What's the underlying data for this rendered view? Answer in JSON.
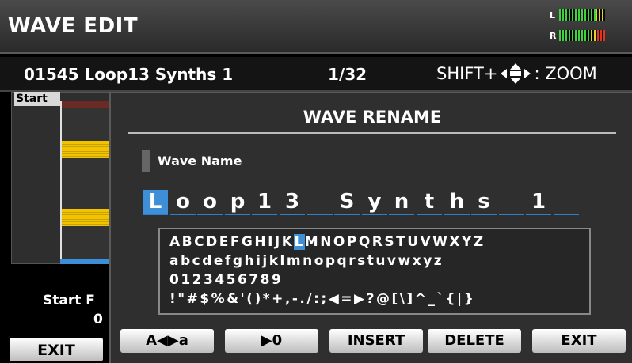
{
  "screen": {
    "title": "WAVE EDIT",
    "meters": [
      {
        "label": "L",
        "level": 0.82
      },
      {
        "label": "R",
        "level": 0.85
      }
    ]
  },
  "info": {
    "wave_name": "01545 Loop13 Synths 1",
    "page": "1/32",
    "zoom_prefix": "SHIFT+",
    "zoom_suffix": ": ZOOM",
    "zoom_icon": "cursor-arrows-icon"
  },
  "background_editor": {
    "start_tag": "Start",
    "start_label": "Start F",
    "start_value": "0",
    "exit_label": "EXIT"
  },
  "dialog": {
    "title": "WAVE RENAME",
    "field_label": "Wave Name",
    "name_chars": [
      "L",
      "o",
      "o",
      "p",
      "1",
      "3",
      " ",
      "S",
      "y",
      "n",
      "t",
      "h",
      "s",
      " ",
      "1",
      " "
    ],
    "cursor_index": 0,
    "charset_rows": [
      {
        "before": "ABCDEFGHIJK",
        "selected": "L",
        "after": "MNOPQRSTUVWXYZ"
      },
      {
        "before": "abcdefghijklmnopqrstuvwxyz",
        "selected": "",
        "after": ""
      },
      {
        "before": "0123456789",
        "selected": "",
        "after": ""
      },
      {
        "before": "!\"#$%&'()*+,-./:;◀=▶?@[\\]^_`{|}",
        "selected": "",
        "after": ""
      }
    ],
    "buttons": {
      "case_label": "A◀▶a",
      "num_label": "▶0",
      "insert_label": "INSERT",
      "delete_label": "DELETE",
      "exit_label": "EXIT"
    }
  },
  "colors": {
    "accent": "#3d8fd8",
    "waveform": "#f2c400"
  }
}
